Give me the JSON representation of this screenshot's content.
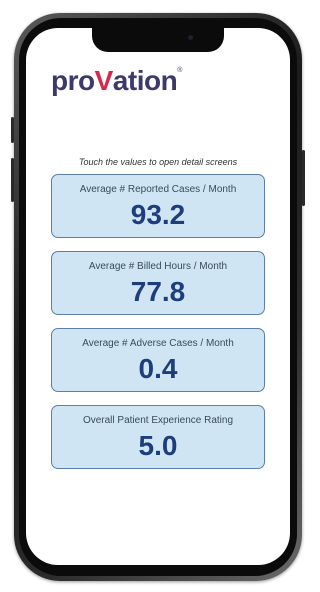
{
  "logo": {
    "part_a": "pro",
    "v": "V",
    "part_b": "ation",
    "reg": "®"
  },
  "hint": "Touch the values to open detail screens",
  "metrics": [
    {
      "label": "Average # Reported Cases / Month",
      "value": "93.2"
    },
    {
      "label": "Average # Billed Hours / Month",
      "value": "77.8"
    },
    {
      "label": "Average # Adverse Cases / Month",
      "value": "0.4"
    },
    {
      "label": "Overall Patient Experience Rating",
      "value": "5.0"
    }
  ],
  "colors": {
    "brand_navy": "#3b3a6b",
    "brand_red": "#d6294d",
    "card_fill": "#cfe5f4",
    "card_border": "#5b7fa6",
    "value_text": "#1f3d7a"
  }
}
